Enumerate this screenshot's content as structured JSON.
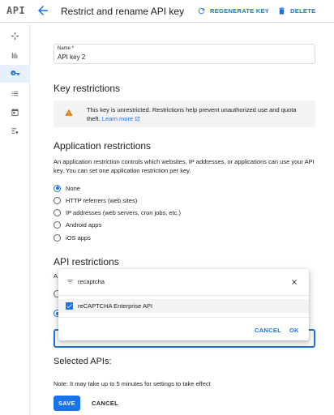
{
  "app": {
    "logo": "API"
  },
  "header": {
    "title": "Restrict and rename API key",
    "regenerate_label": "REGENERATE KEY",
    "delete_label": "DELETE"
  },
  "sidebar": {
    "items": [
      {
        "icon": "api-services-icon"
      },
      {
        "icon": "library-icon"
      },
      {
        "icon": "key-icon",
        "active": true
      },
      {
        "icon": "oauth-consent-icon"
      },
      {
        "icon": "calendar-icon"
      },
      {
        "icon": "settings-list-icon"
      }
    ]
  },
  "name_field": {
    "label": "Name *",
    "value": "API key 2"
  },
  "key_restrictions": {
    "heading": "Key restrictions",
    "warning_text": "This key is unrestricted. Restrictions help prevent unauthorized use and quota theft.",
    "learn_more": "Learn more"
  },
  "application_restrictions": {
    "heading": "Application restrictions",
    "description": "An application restriction controls which websites, IP addresses, or applications can use your API key. You can set one application restriction per key.",
    "options": [
      {
        "label": "None",
        "checked": true
      },
      {
        "label": "HTTP referrers (web sites)",
        "checked": false
      },
      {
        "label": "IP addresses (web servers, cron jobs, etc.)",
        "checked": false
      },
      {
        "label": "Android apps",
        "checked": false
      },
      {
        "label": "iOS apps",
        "checked": false
      }
    ]
  },
  "api_restrictions": {
    "heading": "API restrictions",
    "partial_text": "A",
    "dropdown": {
      "filter_value": "recaptcha",
      "option_label": "reCAPTCHA Enterprise API",
      "option_checked": true,
      "cancel_label": "CANCEL",
      "ok_label": "OK"
    }
  },
  "selected_apis": {
    "heading": "Selected APIs:"
  },
  "note": "Note: It may take up to 5 minutes for settings to take effect",
  "footer": {
    "save_label": "SAVE",
    "cancel_label": "CANCEL"
  },
  "colors": {
    "accent": "#1a73e8",
    "warning": "#e37400",
    "text": "#202124"
  }
}
